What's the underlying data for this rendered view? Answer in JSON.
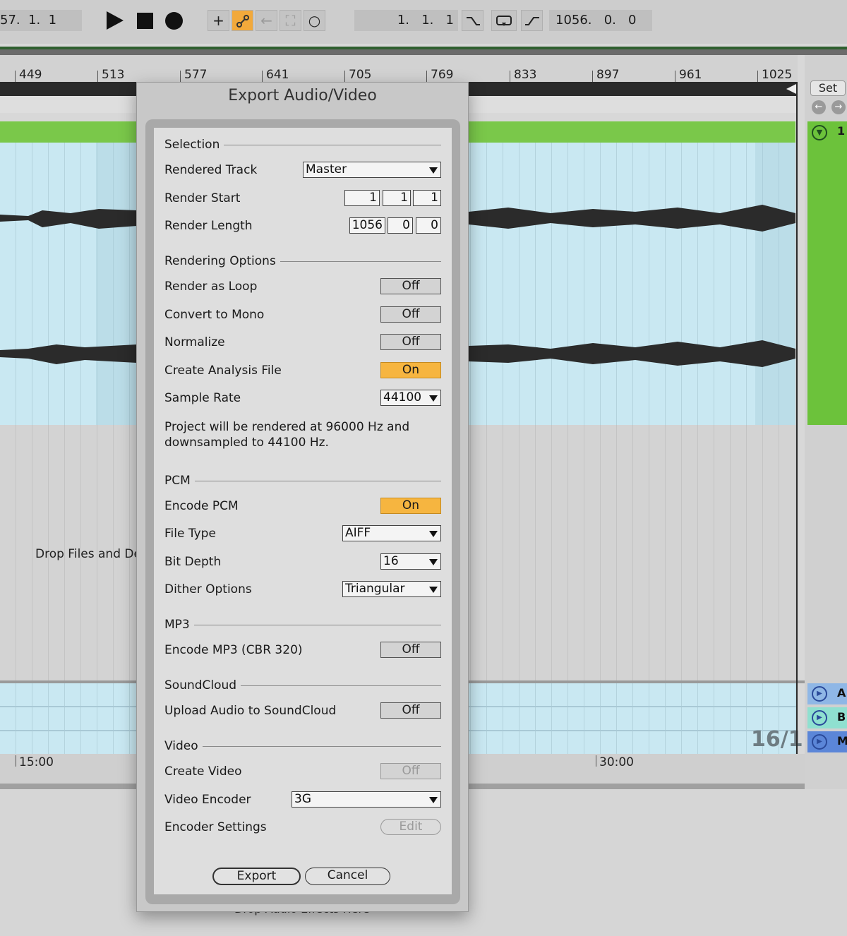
{
  "transport": {
    "song_position": "57.  1.  1",
    "loop_start": "1.   1.   1",
    "loop_length": "1056.   0.   0",
    "buttons": {
      "add": "+",
      "draw": "⌇",
      "back": "←",
      "punch": "⛶",
      "record_circle": "○",
      "punch_in": "⌝",
      "loop": "⟲",
      "punch_out": "⌐"
    },
    "accent_color": "#f2a93b"
  },
  "ruler": {
    "ticks": [
      "449",
      "513",
      "577",
      "641",
      "705",
      "769",
      "833",
      "897",
      "961",
      "1025"
    ]
  },
  "arrangement": {
    "drop_hint": "Drop Files and De",
    "zoom_indicator": "16/1",
    "time_markers": [
      "15:00",
      "30:00"
    ],
    "fx_drop_hint": "Drop Audio Effects Here",
    "clip_color": "#7ac84a"
  },
  "session": {
    "set_label": "Set",
    "track_number": "1",
    "returns": [
      {
        "letter": "A",
        "color": "#8fb7e6"
      },
      {
        "letter": "B",
        "color": "#8fe0d0"
      },
      {
        "letter": "M",
        "color": "#5b86d8"
      }
    ]
  },
  "dialog": {
    "title": "Export Audio/Video",
    "selection": {
      "header": "Selection",
      "rendered_track_label": "Rendered Track",
      "rendered_track_value": "Master",
      "render_start_label": "Render Start",
      "render_start_values": [
        "1",
        "1",
        "1"
      ],
      "render_length_label": "Render Length",
      "render_length_values": [
        "1056",
        "0",
        "0"
      ]
    },
    "rendering": {
      "header": "Rendering Options",
      "render_as_loop_label": "Render as Loop",
      "render_as_loop_value": "Off",
      "convert_to_mono_label": "Convert to Mono",
      "convert_to_mono_value": "Off",
      "normalize_label": "Normalize",
      "normalize_value": "Off",
      "create_analysis_label": "Create Analysis File",
      "create_analysis_value": "On",
      "sample_rate_label": "Sample Rate",
      "sample_rate_value": "44100",
      "note": "Project will be rendered at 96000 Hz and downsampled to 44100 Hz."
    },
    "pcm": {
      "header": "PCM",
      "encode_pcm_label": "Encode PCM",
      "encode_pcm_value": "On",
      "file_type_label": "File Type",
      "file_type_value": "AIFF",
      "bit_depth_label": "Bit Depth",
      "bit_depth_value": "16",
      "dither_label": "Dither Options",
      "dither_value": "Triangular"
    },
    "mp3": {
      "header": "MP3",
      "encode_mp3_label": "Encode MP3 (CBR 320)",
      "encode_mp3_value": "Off"
    },
    "soundcloud": {
      "header": "SoundCloud",
      "upload_label": "Upload Audio to SoundCloud",
      "upload_value": "Off"
    },
    "video": {
      "header": "Video",
      "create_video_label": "Create Video",
      "create_video_value": "Off",
      "encoder_label": "Video Encoder",
      "encoder_value": "3G",
      "settings_label": "Encoder Settings",
      "settings_button": "Edit"
    },
    "export_button": "Export",
    "cancel_button": "Cancel",
    "on_color": "#f6b540"
  }
}
